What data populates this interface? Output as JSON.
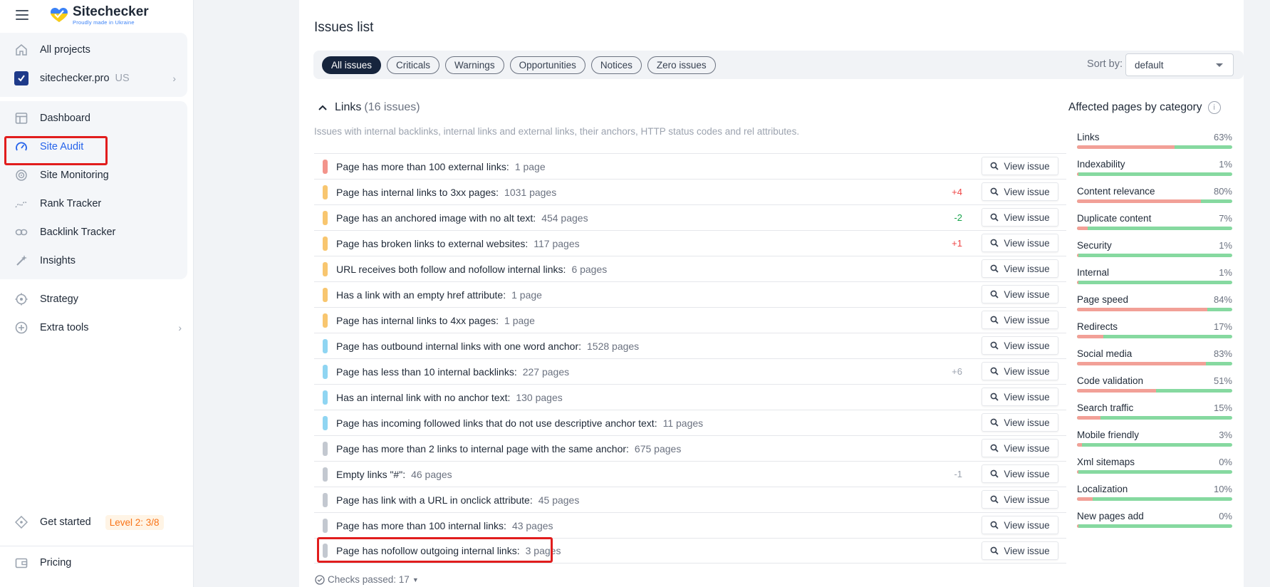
{
  "app": {
    "name": "Sitechecker",
    "tagline": "Proudly made in Ukraine"
  },
  "sidebar": {
    "all_projects": "All projects",
    "project": {
      "name": "sitechecker.pro",
      "region": "US"
    },
    "items": [
      {
        "label": "Dashboard",
        "icon": "dashboard-icon"
      },
      {
        "label": "Site Audit",
        "icon": "gauge-icon"
      },
      {
        "label": "Site Monitoring",
        "icon": "monitoring-icon"
      },
      {
        "label": "Rank Tracker",
        "icon": "rank-icon"
      },
      {
        "label": "Backlink Tracker",
        "icon": "link-icon"
      },
      {
        "label": "Insights",
        "icon": "wand-icon"
      }
    ],
    "strategy": "Strategy",
    "extra_tools": "Extra tools",
    "get_started": "Get started",
    "level": "Level 2: 3/8",
    "pricing": "Pricing"
  },
  "main": {
    "title": "Issues list",
    "filters": [
      "All issues",
      "Criticals",
      "Warnings",
      "Opportunities",
      "Notices",
      "Zero issues"
    ],
    "sort_label": "Sort by:",
    "sort_value": "default",
    "section": {
      "name": "Links",
      "count": "(16 issues)",
      "description": "Issues with internal backlinks, internal links and external links, their anchors, HTTP status codes and rel attributes."
    },
    "view_label": "View issue",
    "checks_passed": "Checks passed: 17"
  },
  "issues": [
    {
      "text": "Page has more than 100 external links:",
      "pages": "1 page",
      "delta": "",
      "severity": "critical"
    },
    {
      "text": "Page has internal links to 3xx pages:",
      "pages": "1031 pages",
      "delta": "+4",
      "severity": "warning"
    },
    {
      "text": "Page has an anchored image with no alt text:",
      "pages": "454 pages",
      "delta": "-2",
      "severity": "warning"
    },
    {
      "text": "Page has broken links to external websites:",
      "pages": "117 pages",
      "delta": "+1",
      "severity": "warning"
    },
    {
      "text": "URL receives both follow and nofollow internal links:",
      "pages": "6 pages",
      "delta": "",
      "severity": "warning"
    },
    {
      "text": "Has a link with an empty href attribute:",
      "pages": "1 page",
      "delta": "",
      "severity": "warning"
    },
    {
      "text": "Page has internal links to 4xx pages:",
      "pages": "1 page",
      "delta": "",
      "severity": "warning"
    },
    {
      "text": "Page has outbound internal links with one word anchor:",
      "pages": "1528 pages",
      "delta": "",
      "severity": "opportunity"
    },
    {
      "text": "Page has less than 10 internal backlinks:",
      "pages": "227 pages",
      "delta": "+6",
      "severity": "opportunity"
    },
    {
      "text": "Has an internal link with no anchor text:",
      "pages": "130 pages",
      "delta": "",
      "severity": "opportunity"
    },
    {
      "text": "Page has incoming followed links that do not use descriptive anchor text:",
      "pages": "11 pages",
      "delta": "",
      "severity": "opportunity"
    },
    {
      "text": "Page has more than 2 links to internal page with the same anchor:",
      "pages": "675 pages",
      "delta": "",
      "severity": "notice"
    },
    {
      "text": "Empty links \"#\":",
      "pages": "46 pages",
      "delta": "-1",
      "severity": "notice"
    },
    {
      "text": "Page has link with a URL in onclick attribute:",
      "pages": "45 pages",
      "delta": "",
      "severity": "notice"
    },
    {
      "text": "Page has more than 100 internal links:",
      "pages": "43 pages",
      "delta": "",
      "severity": "notice"
    },
    {
      "text": "Page has nofollow outgoing internal links:",
      "pages": "3 pages",
      "delta": "",
      "severity": "notice"
    }
  ],
  "severity_colors": {
    "critical": "#f3948b",
    "warning": "#f8c66f",
    "opportunity": "#8fd5f2",
    "notice": "#c3c8d0"
  },
  "delta_colors": {
    "up_red": "#ef4444",
    "down_green": "#16a34a",
    "neutral": "#9ca3af"
  },
  "affected": {
    "title": "Affected pages by category",
    "categories": [
      {
        "name": "Links",
        "pct": "63%",
        "value": 63
      },
      {
        "name": "Indexability",
        "pct": "1%",
        "value": 1
      },
      {
        "name": "Content relevance",
        "pct": "80%",
        "value": 80
      },
      {
        "name": "Duplicate content",
        "pct": "7%",
        "value": 7
      },
      {
        "name": "Security",
        "pct": "1%",
        "value": 1
      },
      {
        "name": "Internal",
        "pct": "1%",
        "value": 1
      },
      {
        "name": "Page speed",
        "pct": "84%",
        "value": 84
      },
      {
        "name": "Redirects",
        "pct": "17%",
        "value": 17
      },
      {
        "name": "Social media",
        "pct": "83%",
        "value": 83
      },
      {
        "name": "Code validation",
        "pct": "51%",
        "value": 51
      },
      {
        "name": "Search traffic",
        "pct": "15%",
        "value": 15
      },
      {
        "name": "Mobile friendly",
        "pct": "3%",
        "value": 3
      },
      {
        "name": "Xml sitemaps",
        "pct": "0%",
        "value": 0
      },
      {
        "name": "Localization",
        "pct": "10%",
        "value": 10
      },
      {
        "name": "New pages add",
        "pct": "0%",
        "value": 0
      }
    ]
  }
}
